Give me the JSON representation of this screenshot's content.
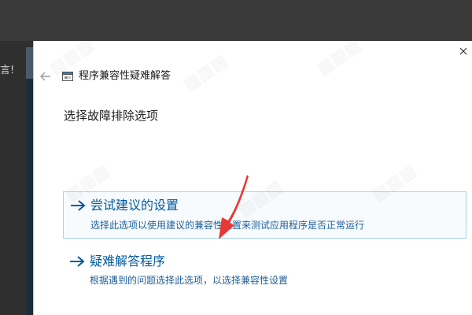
{
  "background": {
    "partial_text": "言!"
  },
  "dialog": {
    "title": "程序兼容性疑难解答",
    "heading": "选择故障排除选项",
    "options": [
      {
        "title": "尝试建议的设置",
        "description": "选择此选项以使用建议的兼容性设置来测试应用程序是否正常运行"
      },
      {
        "title": "疑难解答程序",
        "description": "根据遇到的问题选择此选项，以选择兼容性设置"
      }
    ]
  },
  "icons": {
    "close": "close-icon",
    "back": "back-arrow-icon",
    "app": "compatibility-troubleshooter-icon",
    "option_arrow": "arrow-right-icon"
  },
  "colors": {
    "link": "#005a9e",
    "desc": "#1f5f99",
    "option_border": "#a9d2ee",
    "annotation_arrow": "#e53935"
  }
}
